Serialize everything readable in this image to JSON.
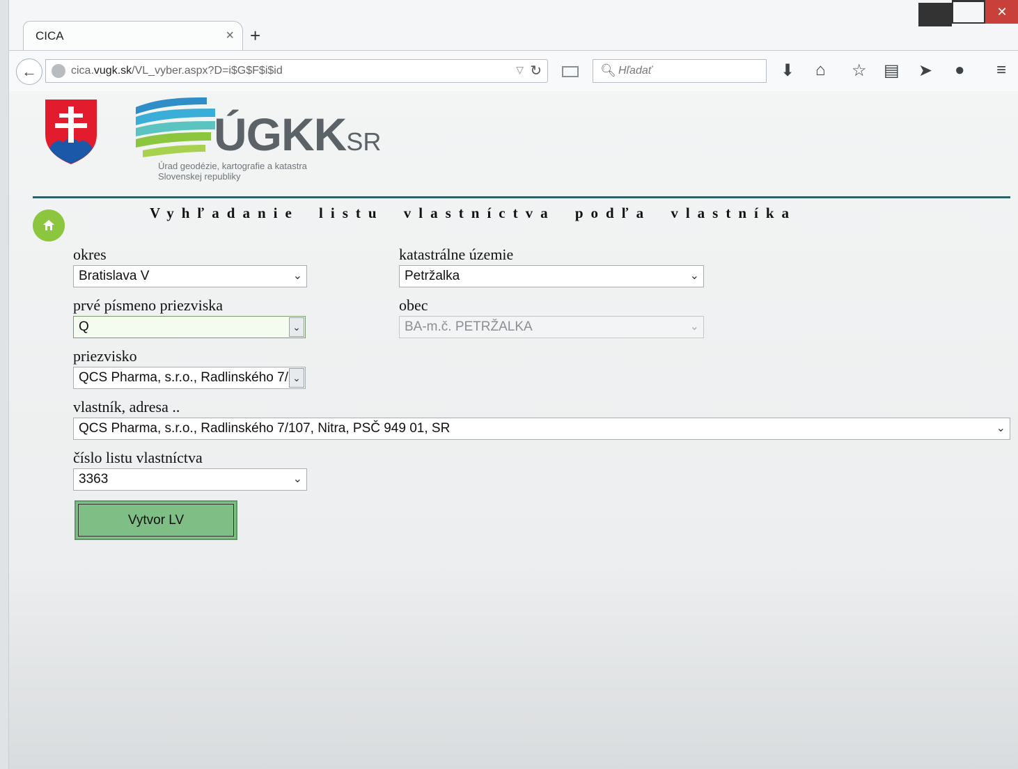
{
  "browser": {
    "tab_title": "CICA",
    "tab_close": "×",
    "new_tab": "+",
    "url_prefix": "cica.",
    "url_domain": "vugk.sk",
    "url_path": "/VL_vyber.aspx?D=i$G$F$i$id",
    "search_placeholder": "Hľadať",
    "window_controls": {
      "minimize": "",
      "maximize": "",
      "close": "✕"
    }
  },
  "header": {
    "logo_main": "ÚGKK",
    "logo_suffix": "SR",
    "logo_subtitle_1": "Úrad geodézie, kartografie a katastra",
    "logo_subtitle_2": "Slovenskej republiky",
    "title": "Vyhľadanie listu vlastníctva podľa vlastníka",
    "colors": {
      "rule": "#2d5e63",
      "home_button": "#8cc63f",
      "submit_button": "#7fbf85"
    }
  },
  "form": {
    "okres": {
      "label": "okres",
      "value": "Bratislava V"
    },
    "katastralne_uzemie": {
      "label": "katastrálne územie",
      "value": "Petržalka"
    },
    "prve_pismeno": {
      "label": "prvé písmeno priezviska",
      "value": "Q"
    },
    "obec": {
      "label": "obec",
      "value": "BA-m.č. PETRŽALKA"
    },
    "priezvisko": {
      "label": "priezvisko",
      "value": "QCS Pharma, s.r.o., Radlinského 7/"
    },
    "vlastnik": {
      "label": "vlastník, adresa ..",
      "value": "QCS Pharma, s.r.o., Radlinského 7/107, Nitra, PSČ 949 01, SR"
    },
    "cislo_lv": {
      "label": "číslo listu vlastníctva",
      "value": "3363"
    },
    "submit_label": "Vytvor LV"
  }
}
